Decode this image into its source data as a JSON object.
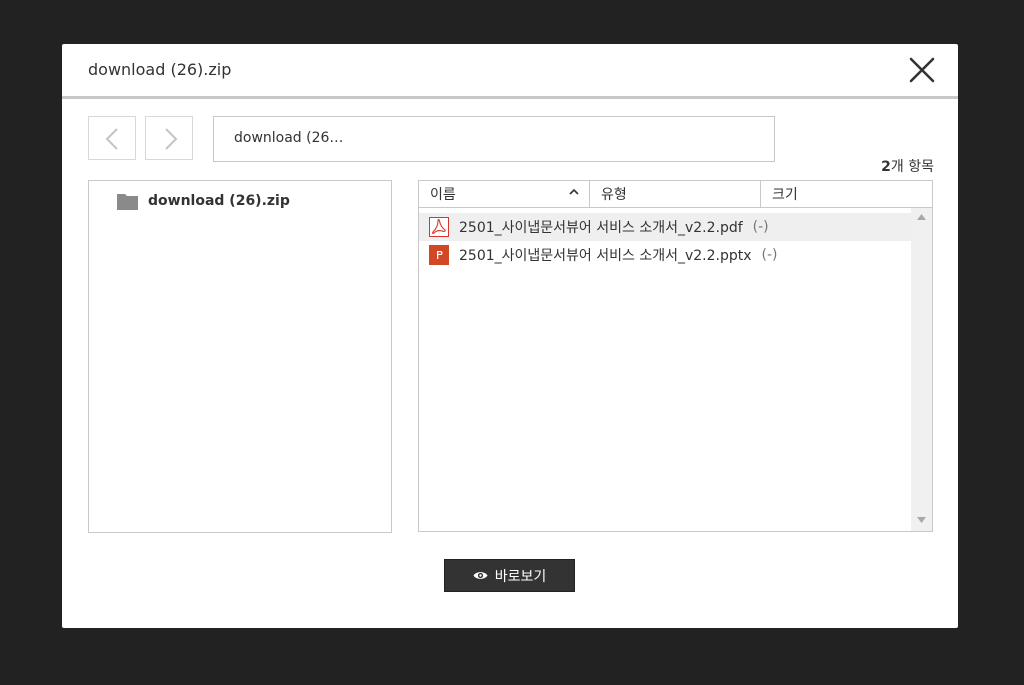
{
  "dialog": {
    "title": "download (26).zip",
    "path_text": "download (26…",
    "item_count_number": "2",
    "item_count_suffix": "개 항목"
  },
  "tree": {
    "root_label": "download (26).zip"
  },
  "list": {
    "columns": [
      {
        "label": "이름",
        "sort": "ascending"
      },
      {
        "label": "유형"
      },
      {
        "label": "크기"
      }
    ],
    "files": [
      {
        "name": "2501_사이냅문서뷰어 서비스 소개서_v2.2.pdf",
        "meta": "(-)",
        "icon": "pdf-icon",
        "selected": true
      },
      {
        "name": "2501_사이냅문서뷰어 서비스 소개서_v2.2.pptx",
        "meta": "(-)",
        "icon": "pptx-icon",
        "selected": false
      }
    ]
  },
  "actions": {
    "preview_label": "바로보기",
    "preview_icon": "eye-icon"
  },
  "colors": {
    "backdrop": "#222222",
    "button_bg": "#333333",
    "pdf_red": "#d9342b",
    "pptx_orange": "#d24726"
  }
}
